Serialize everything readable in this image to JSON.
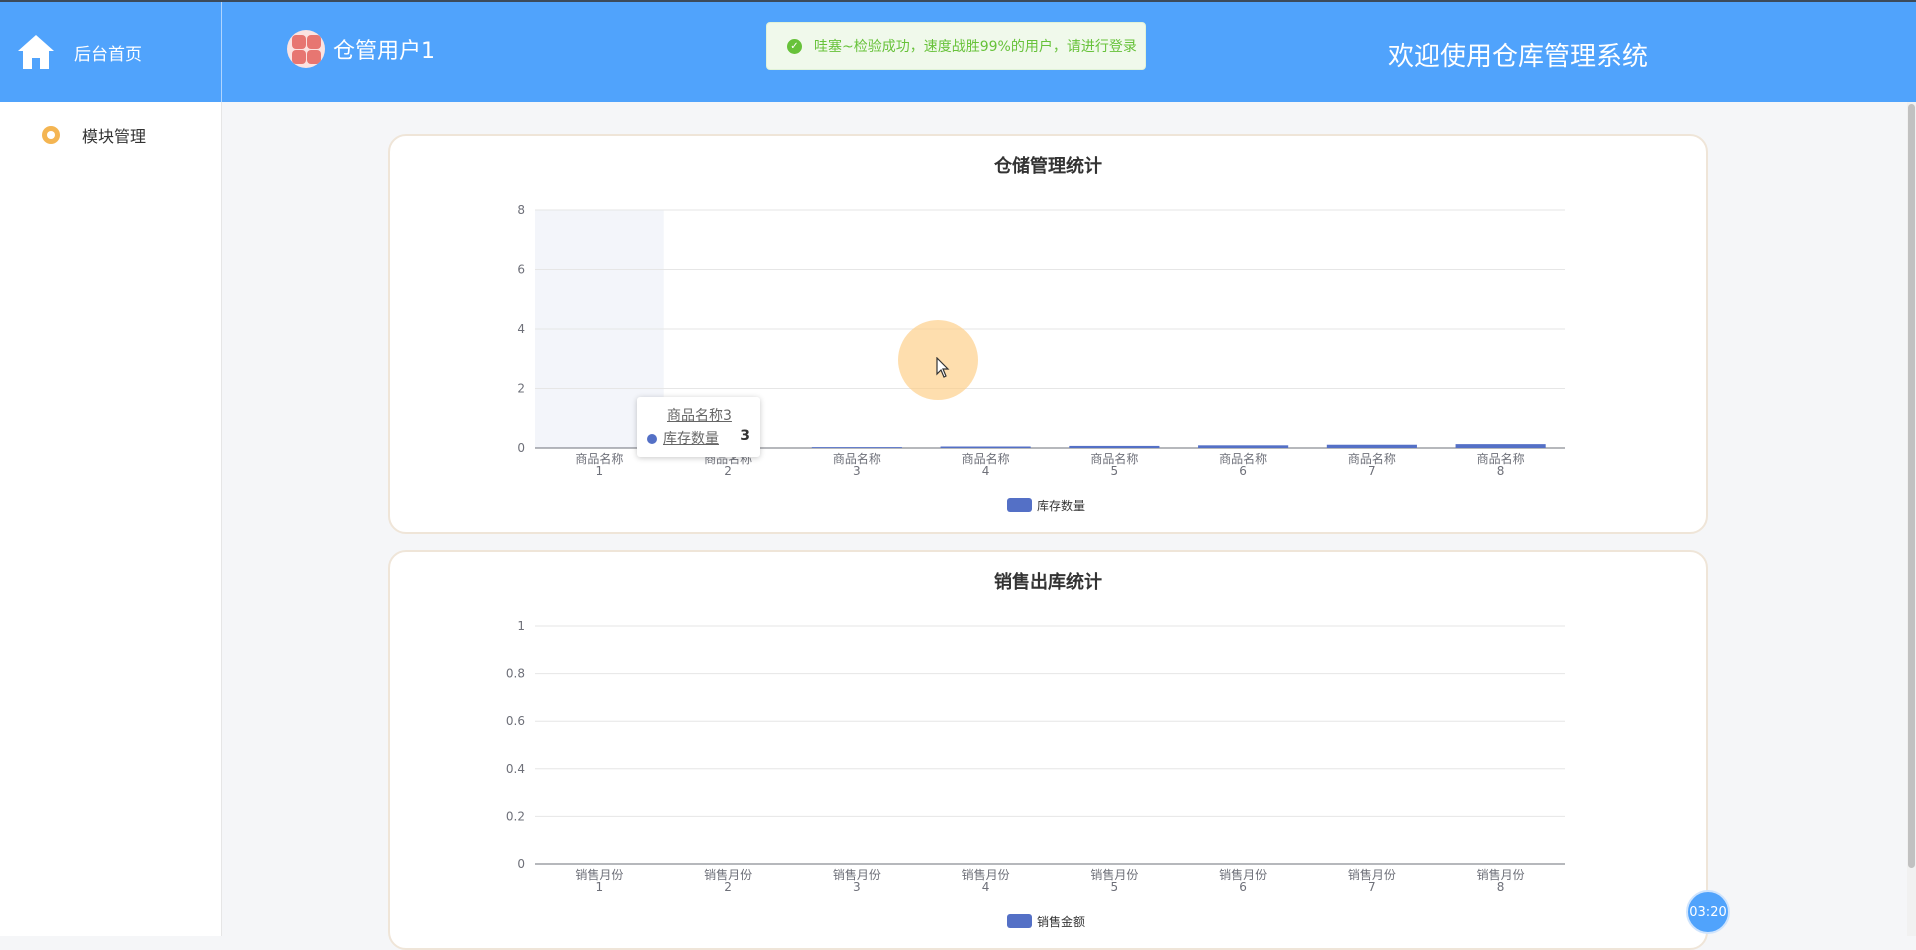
{
  "header": {
    "brand_label": "后台首页",
    "user_name": "仓管用户1",
    "welcome": "欢迎使用仓库管理系统",
    "icons": {
      "brand": "home-icon",
      "avatar": "user-avatar"
    }
  },
  "toast": {
    "type": "success",
    "icon": "check-circle-icon",
    "message": "哇塞~检验成功，速度战胜99%的用户，请进行登录"
  },
  "sidebar": {
    "items": [
      {
        "label": "模块管理",
        "icon": "gear-icon"
      }
    ]
  },
  "colors": {
    "accent": "#50a3fc",
    "series": "#5470c6",
    "success": "#67c23a"
  },
  "tooltip": {
    "title": "商品名称3",
    "series": "库存数量",
    "value": "3"
  },
  "timer": "03:20",
  "chart_data": [
    {
      "type": "bar",
      "title": "仓储管理统计",
      "categories": [
        [
          "商品名称",
          "1"
        ],
        [
          "商品名称",
          "2"
        ],
        [
          "商品名称",
          "3"
        ],
        [
          "商品名称",
          "4"
        ],
        [
          "商品名称",
          "5"
        ],
        [
          "商品名称",
          "6"
        ],
        [
          "商品名称",
          "7"
        ],
        [
          "商品名称",
          "8"
        ]
      ],
      "series": [
        {
          "name": "库存数量",
          "values": [
            0,
            0,
            0.03,
            0.05,
            0.07,
            0.09,
            0.11,
            0.13
          ]
        }
      ],
      "yticks": [
        "0",
        "2",
        "4",
        "6",
        "8"
      ],
      "ylim": [
        0,
        8
      ],
      "grid": true,
      "legend": "bottom-center",
      "highlighted_category": 0
    },
    {
      "type": "bar",
      "title": "销售出库统计",
      "categories": [
        [
          "销售月份",
          "1"
        ],
        [
          "销售月份",
          "2"
        ],
        [
          "销售月份",
          "3"
        ],
        [
          "销售月份",
          "4"
        ],
        [
          "销售月份",
          "5"
        ],
        [
          "销售月份",
          "6"
        ],
        [
          "销售月份",
          "7"
        ],
        [
          "销售月份",
          "8"
        ]
      ],
      "series": [
        {
          "name": "销售金额",
          "values": [
            0,
            0,
            0,
            0,
            0,
            0,
            0,
            0
          ]
        }
      ],
      "yticks": [
        "0",
        "0.2",
        "0.4",
        "0.6",
        "0.8",
        "1"
      ],
      "ylim": [
        0,
        1
      ],
      "grid": true,
      "legend": "bottom-center"
    }
  ]
}
